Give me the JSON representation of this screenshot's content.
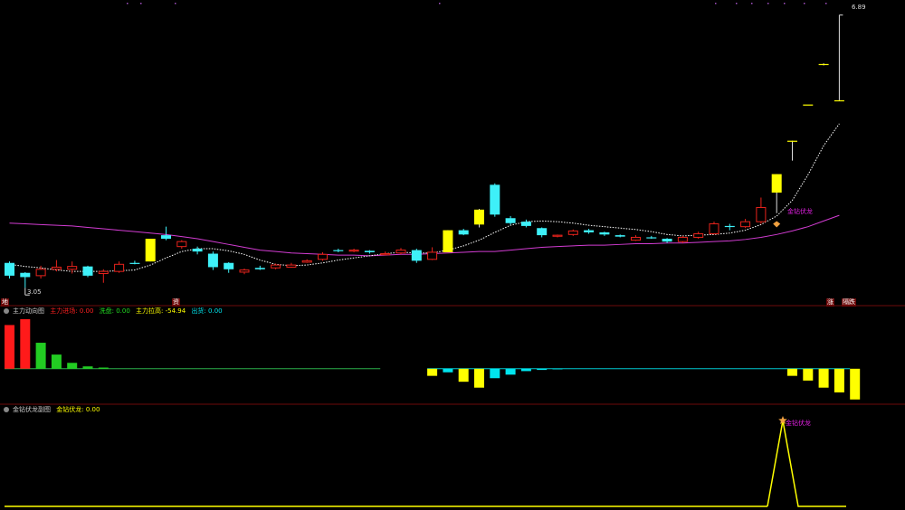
{
  "main": {
    "high_label": "6.89",
    "low_label": "3.05",
    "signal_label": "金钻伏龙",
    "tags": {
      "left": "地",
      "mid": "资",
      "right1": "涨",
      "right2": "隔跌"
    }
  },
  "panel2": {
    "title": "主力动向图",
    "items": [
      {
        "label": "主力进场: 0.00",
        "color": "#ff2020"
      },
      {
        "label": "洗盘: 0.00",
        "color": "#22dd22"
      },
      {
        "label": "主力拉高: -54.94",
        "color": "#ffff00"
      },
      {
        "label": "出货: 0.00",
        "color": "#00e5ee"
      }
    ]
  },
  "panel3": {
    "title": "金钻伏龙副图",
    "value_label": "金钻伏龙: 0.00",
    "signal_label": "金钻伏龙"
  },
  "colors": {
    "up": "#e8231c",
    "down": "#3ef0f8",
    "limit_up": "#ffff00",
    "ma_long": "#d23cd2",
    "ma_short": "#ffffff",
    "divider": "#6e0a0a",
    "signal": "#e020e0"
  },
  "chart_data": [
    {
      "type": "candlestick",
      "ylim": [
        2.9,
        7.0
      ],
      "candles": [
        {
          "o": 3.4,
          "h": 3.42,
          "l": 3.18,
          "c": 3.22,
          "k": "down"
        },
        {
          "o": 3.26,
          "h": 3.27,
          "l": 3.05,
          "c": 3.2,
          "k": "down"
        },
        {
          "o": 3.22,
          "h": 3.36,
          "l": 3.18,
          "c": 3.31,
          "k": "up"
        },
        {
          "o": 3.31,
          "h": 3.44,
          "l": 3.28,
          "c": 3.34,
          "k": "up"
        },
        {
          "o": 3.31,
          "h": 3.42,
          "l": 3.25,
          "c": 3.35,
          "k": "up"
        },
        {
          "o": 3.35,
          "h": 3.36,
          "l": 3.2,
          "c": 3.22,
          "k": "down"
        },
        {
          "o": 3.25,
          "h": 3.31,
          "l": 3.12,
          "c": 3.28,
          "k": "up"
        },
        {
          "o": 3.28,
          "h": 3.42,
          "l": 3.26,
          "c": 3.38,
          "k": "up"
        },
        {
          "o": 3.4,
          "h": 3.43,
          "l": 3.38,
          "c": 3.4,
          "k": "down"
        },
        {
          "o": 3.42,
          "h": 3.74,
          "l": 3.42,
          "c": 3.74,
          "k": "limit"
        },
        {
          "o": 3.79,
          "h": 3.91,
          "l": 3.72,
          "c": 3.74,
          "k": "down"
        },
        {
          "o": 3.63,
          "h": 3.72,
          "l": 3.6,
          "c": 3.7,
          "k": "up"
        },
        {
          "o": 3.6,
          "h": 3.63,
          "l": 3.52,
          "c": 3.56,
          "k": "down"
        },
        {
          "o": 3.53,
          "h": 3.56,
          "l": 3.3,
          "c": 3.34,
          "k": "down"
        },
        {
          "o": 3.4,
          "h": 3.41,
          "l": 3.26,
          "c": 3.31,
          "k": "down"
        },
        {
          "o": 3.27,
          "h": 3.32,
          "l": 3.24,
          "c": 3.3,
          "k": "up"
        },
        {
          "o": 3.33,
          "h": 3.36,
          "l": 3.3,
          "c": 3.31,
          "k": "down"
        },
        {
          "o": 3.33,
          "h": 3.39,
          "l": 3.31,
          "c": 3.37,
          "k": "up"
        },
        {
          "o": 3.34,
          "h": 3.4,
          "l": 3.33,
          "c": 3.37,
          "k": "up"
        },
        {
          "o": 3.41,
          "h": 3.45,
          "l": 3.4,
          "c": 3.43,
          "k": "up"
        },
        {
          "o": 3.45,
          "h": 3.55,
          "l": 3.43,
          "c": 3.52,
          "k": "up"
        },
        {
          "o": 3.58,
          "h": 3.6,
          "l": 3.55,
          "c": 3.57,
          "k": "down"
        },
        {
          "o": 3.57,
          "h": 3.6,
          "l": 3.55,
          "c": 3.58,
          "k": "up"
        },
        {
          "o": 3.57,
          "h": 3.58,
          "l": 3.53,
          "c": 3.55,
          "k": "down"
        },
        {
          "o": 3.52,
          "h": 3.56,
          "l": 3.51,
          "c": 3.53,
          "k": "up"
        },
        {
          "o": 3.54,
          "h": 3.61,
          "l": 3.52,
          "c": 3.58,
          "k": "up"
        },
        {
          "o": 3.58,
          "h": 3.6,
          "l": 3.4,
          "c": 3.43,
          "k": "down"
        },
        {
          "o": 3.45,
          "h": 3.62,
          "l": 3.44,
          "c": 3.55,
          "k": "up"
        },
        {
          "o": 3.55,
          "h": 3.86,
          "l": 3.55,
          "c": 3.86,
          "k": "limit"
        },
        {
          "o": 3.86,
          "h": 3.88,
          "l": 3.79,
          "c": 3.8,
          "k": "down"
        },
        {
          "o": 3.94,
          "h": 4.16,
          "l": 3.9,
          "c": 4.15,
          "k": "limit"
        },
        {
          "o": 4.5,
          "h": 4.52,
          "l": 4.05,
          "c": 4.08,
          "k": "down"
        },
        {
          "o": 4.03,
          "h": 4.06,
          "l": 3.94,
          "c": 3.96,
          "k": "down"
        },
        {
          "o": 3.98,
          "h": 4.01,
          "l": 3.9,
          "c": 3.92,
          "k": "down"
        },
        {
          "o": 3.89,
          "h": 3.9,
          "l": 3.76,
          "c": 3.79,
          "k": "down"
        },
        {
          "o": 3.78,
          "h": 3.8,
          "l": 3.76,
          "c": 3.79,
          "k": "up"
        },
        {
          "o": 3.8,
          "h": 3.87,
          "l": 3.78,
          "c": 3.85,
          "k": "up"
        },
        {
          "o": 3.86,
          "h": 3.88,
          "l": 3.81,
          "c": 3.83,
          "k": "down"
        },
        {
          "o": 3.83,
          "h": 3.84,
          "l": 3.78,
          "c": 3.8,
          "k": "down"
        },
        {
          "o": 3.79,
          "h": 3.8,
          "l": 3.76,
          "c": 3.77,
          "k": "down"
        },
        {
          "o": 3.72,
          "h": 3.79,
          "l": 3.71,
          "c": 3.76,
          "k": "up"
        },
        {
          "o": 3.76,
          "h": 3.78,
          "l": 3.74,
          "c": 3.75,
          "k": "down"
        },
        {
          "o": 3.74,
          "h": 3.75,
          "l": 3.68,
          "c": 3.7,
          "k": "down"
        },
        {
          "o": 3.7,
          "h": 3.78,
          "l": 3.68,
          "c": 3.76,
          "k": "up"
        },
        {
          "o": 3.76,
          "h": 3.84,
          "l": 3.74,
          "c": 3.81,
          "k": "up"
        },
        {
          "o": 3.81,
          "h": 3.98,
          "l": 3.8,
          "c": 3.95,
          "k": "up"
        },
        {
          "o": 3.92,
          "h": 3.95,
          "l": 3.86,
          "c": 3.91,
          "k": "down"
        },
        {
          "o": 3.91,
          "h": 4.02,
          "l": 3.89,
          "c": 3.98,
          "k": "up"
        },
        {
          "o": 3.98,
          "h": 4.32,
          "l": 3.95,
          "c": 4.18,
          "k": "up"
        },
        {
          "o": 4.39,
          "h": 4.65,
          "l": 4.1,
          "c": 4.65,
          "k": "limit"
        },
        {
          "o": 5.12,
          "h": 5.12,
          "l": 4.84,
          "c": 5.12,
          "k": "limit"
        },
        {
          "o": 5.63,
          "h": 5.63,
          "l": 5.63,
          "c": 5.63,
          "k": "limit"
        },
        {
          "o": 6.2,
          "h": 6.21,
          "l": 6.18,
          "c": 6.2,
          "k": "limit"
        },
        {
          "o": 5.69,
          "h": 6.89,
          "l": 5.69,
          "c": 5.69,
          "k": "limit"
        }
      ],
      "ma_short": [
        3.38,
        3.35,
        3.33,
        3.3,
        3.28,
        3.28,
        3.28,
        3.29,
        3.3,
        3.37,
        3.47,
        3.56,
        3.6,
        3.6,
        3.57,
        3.52,
        3.44,
        3.38,
        3.36,
        3.37,
        3.4,
        3.44,
        3.47,
        3.5,
        3.53,
        3.55,
        3.54,
        3.54,
        3.58,
        3.64,
        3.72,
        3.83,
        3.93,
        3.98,
        3.99,
        3.98,
        3.96,
        3.93,
        3.91,
        3.89,
        3.87,
        3.84,
        3.8,
        3.78,
        3.79,
        3.8,
        3.82,
        3.86,
        3.94,
        4.06,
        4.28,
        4.64,
        5.05,
        5.36
      ],
      "ma_long": [
        3.96,
        3.95,
        3.94,
        3.93,
        3.92,
        3.9,
        3.88,
        3.86,
        3.84,
        3.82,
        3.8,
        3.77,
        3.74,
        3.7,
        3.66,
        3.62,
        3.58,
        3.56,
        3.54,
        3.53,
        3.52,
        3.51,
        3.51,
        3.5,
        3.51,
        3.52,
        3.52,
        3.53,
        3.54,
        3.55,
        3.56,
        3.56,
        3.58,
        3.6,
        3.62,
        3.63,
        3.64,
        3.65,
        3.65,
        3.66,
        3.67,
        3.67,
        3.68,
        3.68,
        3.69,
        3.7,
        3.71,
        3.73,
        3.76,
        3.8,
        3.85,
        3.91,
        3.99,
        4.07
      ]
    },
    {
      "type": "bar",
      "ylim": [
        -30,
        45
      ],
      "series": [
        {
          "values": [
            37,
            42,
            22,
            12,
            5,
            2,
            1,
            0.4,
            0.3,
            0.2,
            0.2,
            0.2,
            0.2,
            0.2,
            0.1,
            0.1,
            0.1,
            0.1,
            0.1,
            0.1,
            0.1,
            0.1,
            0.1,
            0.1,
            0,
            0,
            0,
            -6,
            -3,
            -11,
            -16,
            -8,
            -5,
            -2,
            -1,
            -0.5,
            -0.3,
            -0.3,
            -0.3,
            -0.3,
            -0.3,
            -0.3,
            -0.3,
            -0.3,
            -0.3,
            -0.3,
            -0.3,
            -0.3,
            -0.3,
            -0.3,
            -6,
            -10,
            -16,
            -20,
            -26
          ]
        }
      ]
    },
    {
      "type": "line",
      "ylim": [
        0,
        100
      ],
      "x": [
        848,
        865,
        882,
        935
      ],
      "values": [
        0,
        95,
        0,
        0
      ]
    }
  ]
}
